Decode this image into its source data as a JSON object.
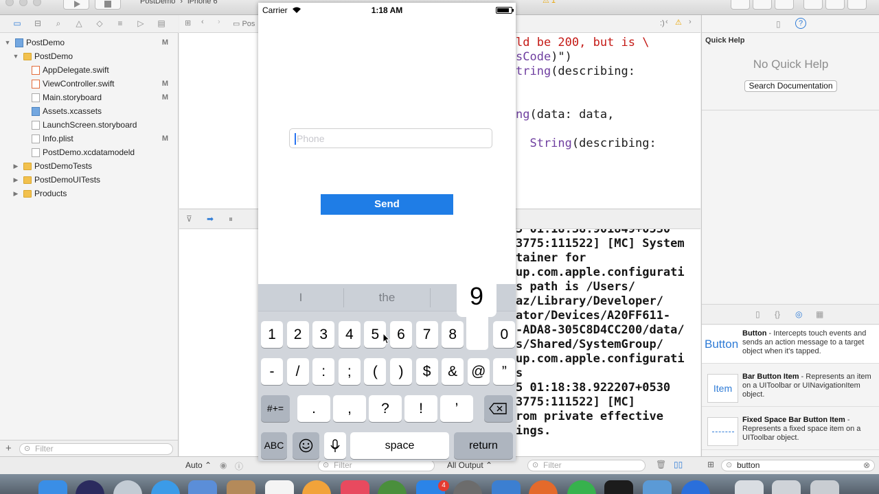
{
  "toolbar": {
    "scheme_project": "PostDemo",
    "scheme_device": "iPhone 6",
    "warning_count": "1"
  },
  "navigator": {
    "items": [
      {
        "label": "PostDemo",
        "status": "M",
        "kind": "project",
        "indent": 0,
        "disclosure": "▼"
      },
      {
        "label": "PostDemo",
        "status": "",
        "kind": "folder",
        "indent": 1,
        "disclosure": "▼"
      },
      {
        "label": "AppDelegate.swift",
        "status": "",
        "kind": "swift",
        "indent": 2,
        "disclosure": ""
      },
      {
        "label": "ViewController.swift",
        "status": "M",
        "kind": "swift",
        "indent": 2,
        "disclosure": ""
      },
      {
        "label": "Main.storyboard",
        "status": "M",
        "kind": "file",
        "indent": 2,
        "disclosure": ""
      },
      {
        "label": "Assets.xcassets",
        "status": "",
        "kind": "assets",
        "indent": 2,
        "disclosure": ""
      },
      {
        "label": "LaunchScreen.storyboard",
        "status": "",
        "kind": "file",
        "indent": 2,
        "disclosure": ""
      },
      {
        "label": "Info.plist",
        "status": "M",
        "kind": "file",
        "indent": 2,
        "disclosure": ""
      },
      {
        "label": "PostDemo.xcdatamodeld",
        "status": "",
        "kind": "file",
        "indent": 2,
        "disclosure": ""
      },
      {
        "label": "PostDemoTests",
        "status": "",
        "kind": "folder",
        "indent": 1,
        "disclosure": "▶"
      },
      {
        "label": "PostDemoUITests",
        "status": "",
        "kind": "folder",
        "indent": 1,
        "disclosure": "▶"
      },
      {
        "label": "Products",
        "status": "",
        "kind": "folder",
        "indent": 1,
        "disclosure": "▶"
      }
    ],
    "filter_placeholder": "Filter"
  },
  "jumpbar": {
    "crumb": "Pos",
    "tail": ":)"
  },
  "editor": {
    "lines": [
      [
        {
          "t": "ld be 200, but is \\",
          "c": "str"
        }
      ],
      [
        {
          "t": "sCode",
          "c": "kw"
        },
        {
          "t": ")\")",
          "c": "pl"
        }
      ],
      [
        {
          "t": "tring",
          "c": "kw"
        },
        {
          "t": "(describing:",
          "c": "pl"
        }
      ],
      [],
      [],
      [
        {
          "t": "ng",
          "c": "kw"
        },
        {
          "t": "(data: data,",
          "c": "pl"
        }
      ],
      [],
      [
        {
          "t": "  String",
          "c": "kw"
        },
        {
          "t": "(describing:",
          "c": "pl"
        }
      ]
    ]
  },
  "console": {
    "lines": [
      "5 01:18:38.901849+0530",
      "3775:111522] [MC] System",
      "tainer for",
      "up.com.apple.configurati",
      "s path is /Users/",
      "az/Library/Developer/",
      "ator/Devices/A20FF611-",
      "-ADA8-305C8D4CC200/data/",
      "s/Shared/SystemGroup/",
      "up.com.apple.configurati",
      "s",
      "5 01:18:38.922207+0530",
      "3775:111522] [MC]",
      "rom private effective",
      "ings."
    ]
  },
  "inspector": {
    "quick_help_title": "Quick Help",
    "no_quick_help": "No Quick Help",
    "search_docs": "Search Documentation",
    "library": [
      {
        "icon_text": "Button",
        "title": "Button",
        "desc": " - Intercepts touch events and sends an action message to a target object when it's tapped."
      },
      {
        "icon_text": "Item",
        "title": "Bar Button Item",
        "desc": " - Represents an item on a UIToolbar or UINavigationItem object."
      },
      {
        "icon_text": "",
        "title": "Fixed Space Bar Button Item",
        "desc": " - Represents a fixed space item on a UIToolbar object."
      }
    ],
    "library_filter": "button"
  },
  "bottombar": {
    "auto_label": "Auto ⌃",
    "all_output": "All Output ⌃",
    "filter": "Filter"
  },
  "simulator": {
    "carrier": "Carrier",
    "time": "1:18 AM",
    "phone_placeholder": "Phone",
    "send_label": "Send",
    "predictions": [
      "I",
      "the",
      ""
    ],
    "popup_key": "9",
    "row1": [
      "1",
      "2",
      "3",
      "4",
      "5",
      "6",
      "7",
      "8",
      "",
      "0"
    ],
    "row2": [
      "-",
      "/",
      ":",
      ";",
      "(",
      ")",
      "$",
      "&",
      "@",
      "”"
    ],
    "row3_left": "#+=",
    "row3": [
      ".",
      ",",
      "?",
      "!",
      "’"
    ],
    "abc": "ABC",
    "space": "space",
    "return": "return"
  },
  "dock": {
    "badge": "4"
  },
  "colors": {
    "accent": "#1f7de6",
    "string_red": "#c41a16",
    "keyword_purple": "#6f3fa0"
  }
}
